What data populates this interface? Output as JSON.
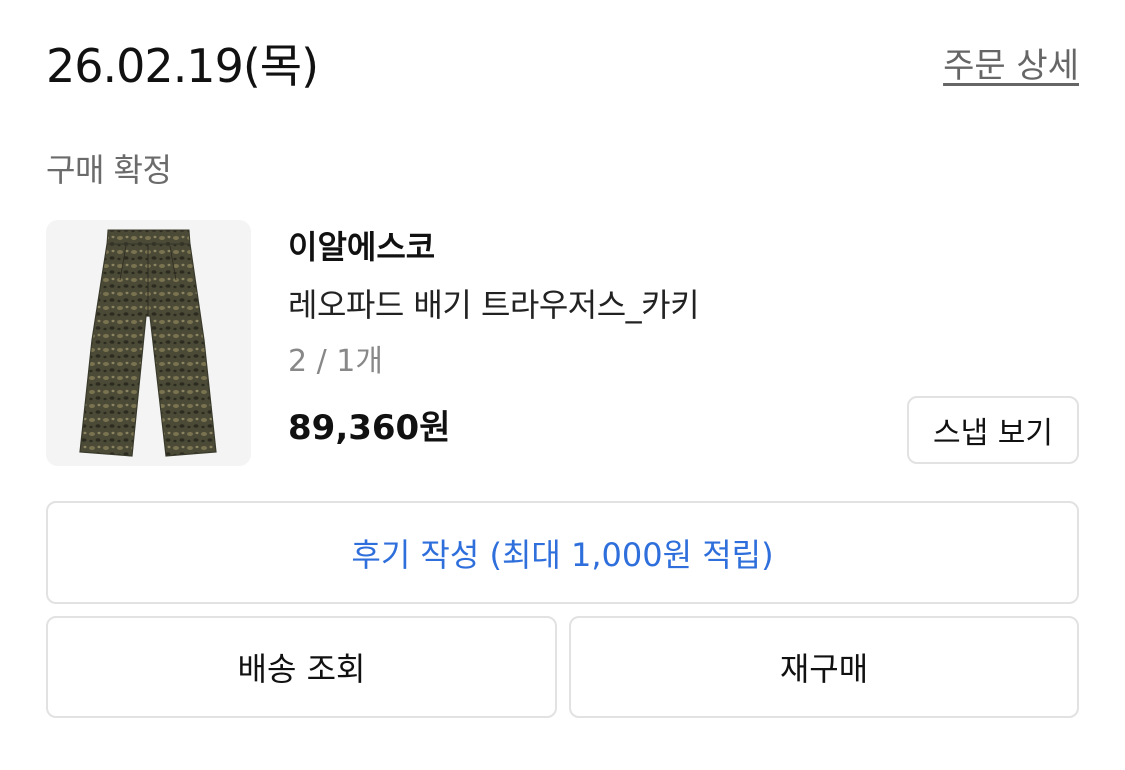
{
  "order": {
    "date": "26.02.19(목)",
    "detail_link": "주문 상세",
    "status": "구매 확정"
  },
  "product": {
    "brand": "이알에스코",
    "name": "레오파드 배기 트라우저스_카키",
    "option": "2 / 1개",
    "price": "89,360원",
    "image_icon": "leopard-trousers-photo"
  },
  "buttons": {
    "snap": "스냅 보기",
    "review": "후기 작성 (최대 1,000원 적립)",
    "delivery": "배송 조회",
    "rebuy": "재구매"
  },
  "colors": {
    "review_accent": "#2f6fdc",
    "trousers_base": "#4a4a38",
    "border": "#e2e2e2"
  }
}
